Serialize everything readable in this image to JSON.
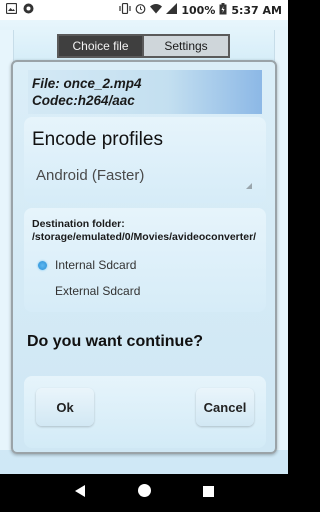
{
  "status_bar": {
    "battery_percent": "100%",
    "time": "5:37 AM"
  },
  "tabs": [
    {
      "label": "Choice file",
      "active": true
    },
    {
      "label": "Settings",
      "active": false
    }
  ],
  "dialog": {
    "file_line": "File: once_2.mp4",
    "codec_line": "Codec:h264/aac",
    "profiles_title": "Encode profiles",
    "profile_selected": "Android (Faster)",
    "destination_text": "Destination folder: /storage/emulated/0/Movies/avideoconverter/",
    "storage_options": [
      {
        "label": "Internal Sdcard",
        "selected": true
      },
      {
        "label": "External Sdcard",
        "selected": false
      }
    ],
    "question": "Do you want continue?",
    "ok_label": "Ok",
    "cancel_label": "Cancel"
  },
  "colors": {
    "radio_selected": "#2a8fd6",
    "tab_active_bg": "#3f3f3f",
    "file_info_gradient_end": "#8cb8e6"
  }
}
